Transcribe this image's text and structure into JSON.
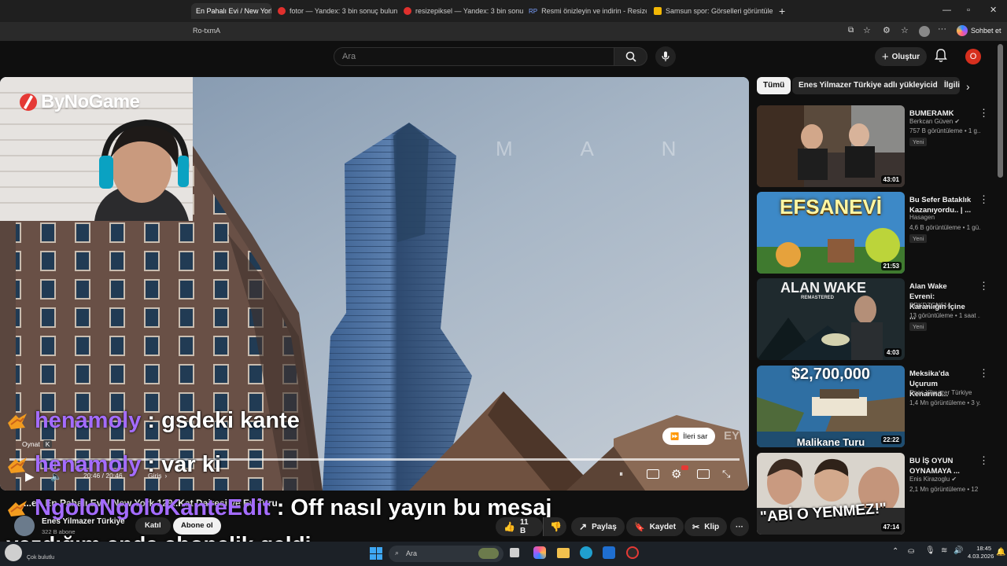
{
  "browser": {
    "tabs": [
      {
        "label": "En Pahalı Evi / New York",
        "active": true
      },
      {
        "label": "fotor — Yandex: 3 bin sonuç bulun"
      },
      {
        "label": "resizepiksel — Yandex: 3 bin sonuç"
      },
      {
        "label": "Resmi önizleyin ve indirin - Resize"
      },
      {
        "label": "Samsun spor: Görselleri görüntüle"
      }
    ],
    "url_fragment": "Ro-txmA",
    "chat_button": "Sohbet et"
  },
  "header": {
    "search_placeholder": "Ara",
    "create_label": "Oluştur",
    "avatar_letter": "O"
  },
  "overlay": {
    "logo_text": "ByNoGame",
    "chat": [
      {
        "user": "henamoly",
        "sep": " : ",
        "message": "gsdeki kante"
      },
      {
        "user": "henamoly",
        "sep": " : ",
        "message": "var ki"
      },
      {
        "user": "NgoloNgoloKanteEdit",
        "sep": " : ",
        "message": "Off nasıl yayın bu mesaj"
      }
    ],
    "chat_wrap": "yazdığım anda abonelik geldi"
  },
  "player": {
    "play_tooltip": "Oynat",
    "play_shortcut": "K",
    "time": "20:46 / 20:46",
    "chapter": "Giriş",
    "skip_label": "İleri sar",
    "watermark": "EY"
  },
  "video": {
    "title_partial": "...en En Pahalı Evi / New York 129..Kat Dairesi ve Ev Turu",
    "channel": "Enes Yilmazer Türkiye",
    "subs": "322 B abone",
    "join_label": "Katıl",
    "subscribe_label": "Abone ol",
    "likes": "11 B",
    "share_label": "Paylaş",
    "save_label": "Kaydet",
    "clip_label": "Klip"
  },
  "chips": [
    {
      "label": "Tümü",
      "selected": true
    },
    {
      "label": "Enes Yilmazer Türkiye adlı yükleyiciden"
    },
    {
      "label": "İlgili"
    }
  ],
  "recommendations": [
    {
      "title": "BUMERAMK",
      "channel": "Berkcan Güven",
      "verified": true,
      "stats": "757 B görüntüleme • 1 g...",
      "badge": "Yeni",
      "duration": "43:01"
    },
    {
      "title": "Bu Sefer Bataklık Kazanıyordu.. | ...",
      "channel": "Hasagen",
      "verified": false,
      "stats": "4,6 B görüntüleme • 1 gü...",
      "badge": "Yeni",
      "duration": "21:53",
      "thumb_text": "EFSANEVİ"
    },
    {
      "title": "Alan Wake Evreni: Karanlığın İçine ...",
      "channel": "BRKDZGN614",
      "verified": false,
      "stats": "13 görüntüleme • 1 saat ...",
      "badge": "Yeni",
      "duration": "4:03",
      "thumb_text": "ALAN WAKE",
      "thumb_sub": "REMASTERED"
    },
    {
      "title": "Meksika'da Uçurum Kenarınd...",
      "channel": "Enes Yilmazer Türkiye",
      "verified": false,
      "stats": "1,4 Mn görüntüleme • 3 y...",
      "badge": "",
      "duration": "22:22",
      "thumb_text": "$2,700,000",
      "thumb_sub": "Malikane Turu"
    },
    {
      "title": "BU İŞ OYUN OYNAMAYA ...",
      "channel": "Enis Kirazoglu",
      "verified": true,
      "stats": "2,1 Mn görüntüleme • 12 ...",
      "badge": "",
      "duration": "47:14",
      "thumb_text": "\"ABİ O YENMEZ!\""
    }
  ],
  "taskbar": {
    "weather": "Çok bulutlu",
    "search": "Ara",
    "time": "18:45",
    "date": "4.03.2026"
  }
}
